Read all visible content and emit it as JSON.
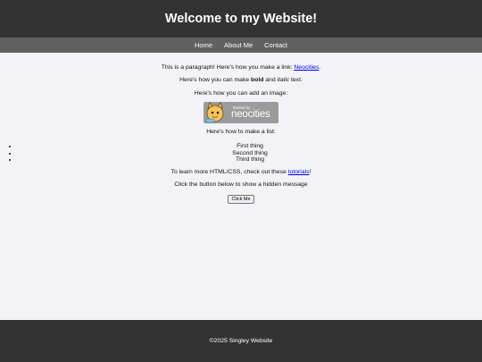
{
  "header": {
    "title": "Welcome to my Website!"
  },
  "nav": {
    "items": [
      {
        "label": "Home"
      },
      {
        "label": "About Me"
      },
      {
        "label": "Contact"
      }
    ]
  },
  "main": {
    "p1_before": "This is a paragraph! Here's how you make a link: ",
    "p1_link": "Neocities",
    "p1_after": ".",
    "p2_before": "Here's how you can make ",
    "p2_bold": "bold",
    "p2_mid": " and ",
    "p2_italic": "italic",
    "p2_after": " text.",
    "p3": "Here's how you can add an image:",
    "badge": {
      "small": "hosted by",
      "big": "neocities"
    },
    "p4": "Here's how to make a list:",
    "list": [
      "First thing",
      "Second thing",
      "Third thing"
    ],
    "p5_before": "To learn more HTML/CSS, check out these ",
    "p5_link": "tutorials",
    "p5_after": "!",
    "p6": "Click the button below to show a hidden message",
    "button_label": "Click Me"
  },
  "footer": {
    "text": "©2025 Singley Website"
  },
  "colors": {
    "header_bg": "#333333",
    "nav_bg": "#616161",
    "page_bg": "#f3f2f7",
    "link": "#0000ee"
  }
}
